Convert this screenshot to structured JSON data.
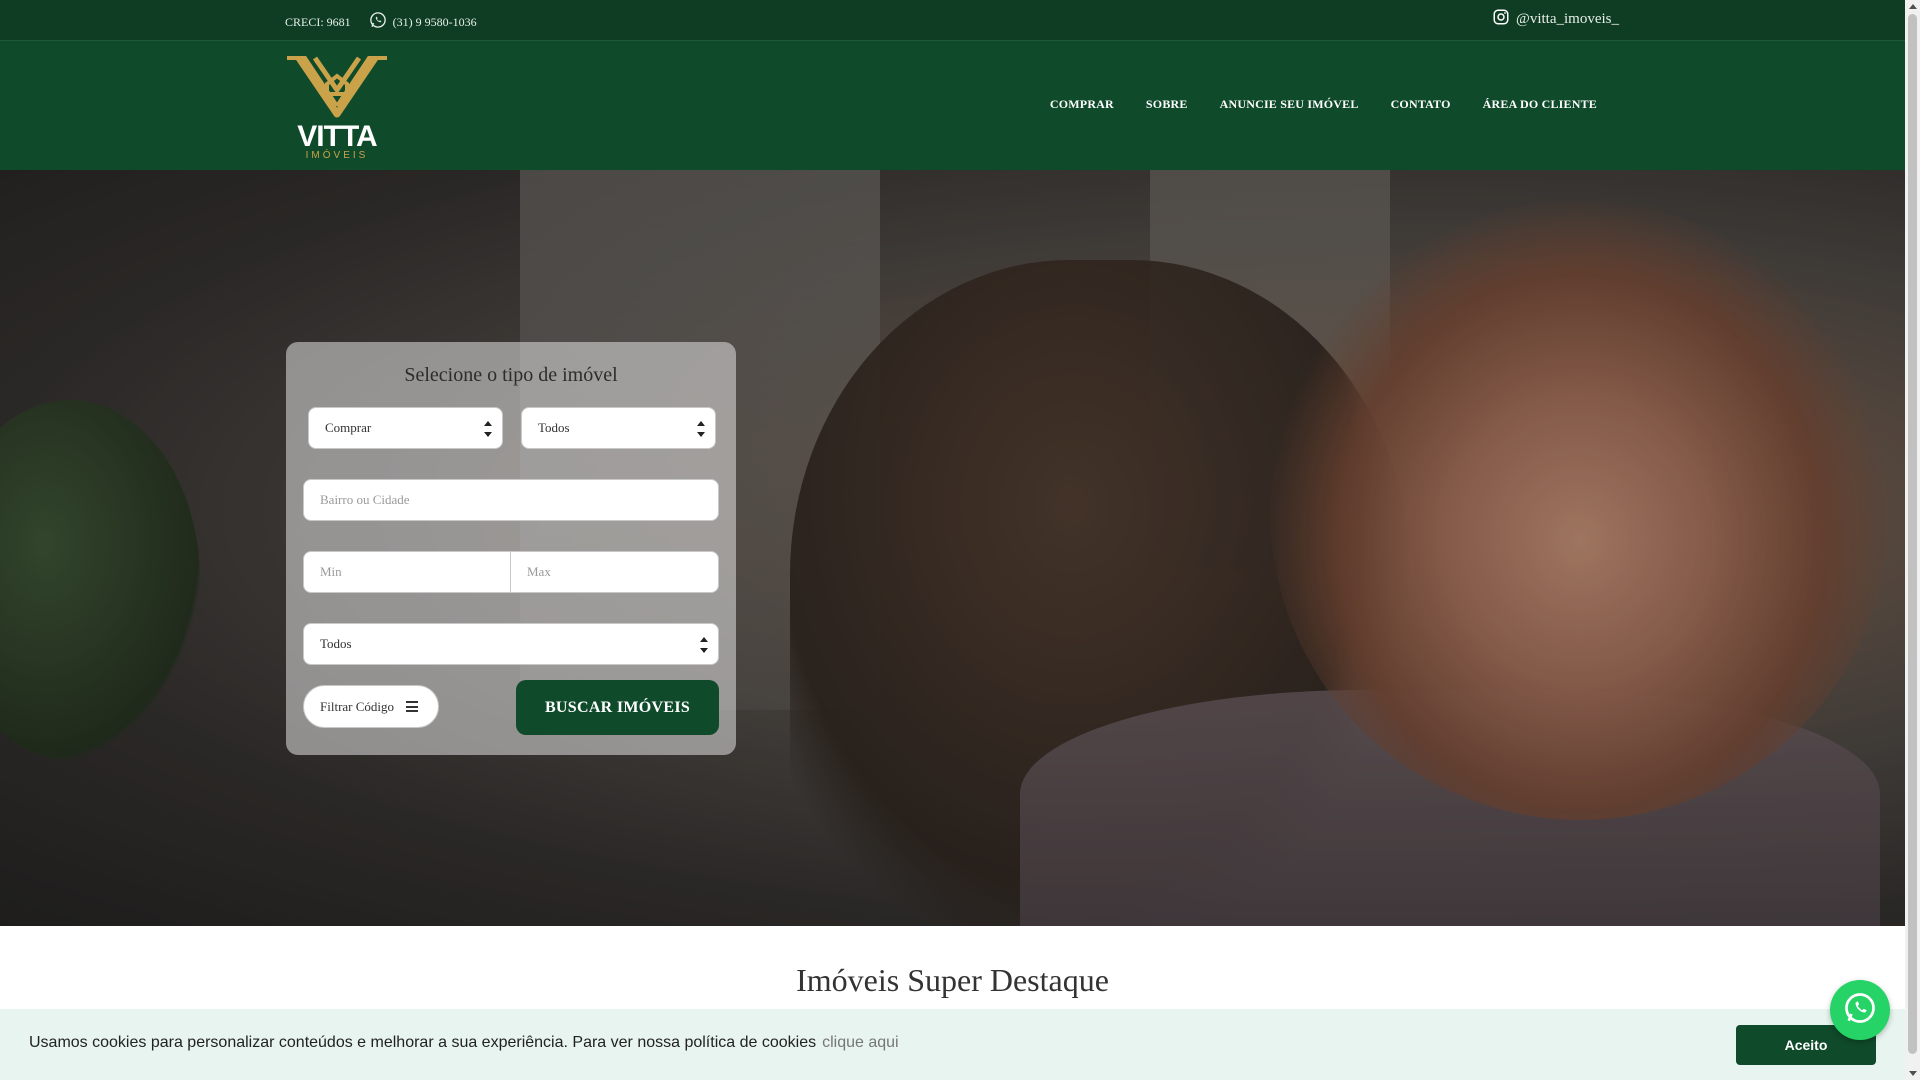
{
  "topbar": {
    "creci": "CRECI: 9681",
    "phone": "(31) 9 9580-1036",
    "instagram": "@vitta_imoveis_",
    "phone_icon": "whatsapp-icon",
    "instagram_icon": "instagram-icon"
  },
  "brand": {
    "name": "VITTA",
    "sub": "IMÓVEIS",
    "gold": "#c9a24a"
  },
  "nav": {
    "items": [
      {
        "label": "COMPRAR"
      },
      {
        "label": "SOBRE"
      },
      {
        "label": "ANUNCIE SEU IMÓVEL"
      },
      {
        "label": "CONTATO"
      },
      {
        "label": "ÁREA DO CLIENTE"
      }
    ]
  },
  "search": {
    "title": "Selecione o tipo de imóvel",
    "operation": "Comprar",
    "type": "Todos",
    "location_placeholder": "Bairro ou Cidade",
    "min_placeholder": "Min",
    "max_placeholder": "Max",
    "extra": "Todos",
    "code_button": "Filtrar Código",
    "search_button": "BUSCAR IMÓVEIS"
  },
  "section": {
    "title": "Imóveis Super Destaque"
  },
  "cookie": {
    "message": "Usamos cookies para personalizar conteúdos e melhorar a sua experiência. Para ver nossa política de cookies",
    "link": "clique aqui",
    "accept": "Aceito"
  },
  "colors": {
    "primary": "#0f4a2a",
    "topbar": "#0f3d24",
    "whatsapp": "#25d366"
  }
}
